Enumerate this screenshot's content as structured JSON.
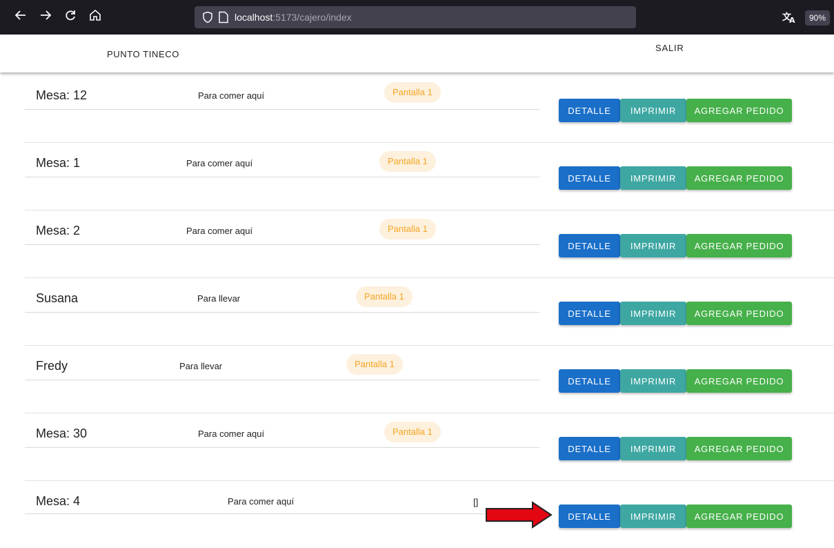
{
  "browser": {
    "url_host": "localhost",
    "url_rest": ":5173/cajero/index",
    "zoom": "90%",
    "icons": [
      "back-icon",
      "forward-icon",
      "reload-icon",
      "home-icon",
      "shield-icon",
      "page-icon",
      "translate-icon"
    ]
  },
  "header": {
    "brand": "PUNTO TINECO",
    "logout_label": "SALIR"
  },
  "buttons": {
    "detalle": "DETALLE",
    "imprimir": "IMPRIMIR",
    "agregar": "AGREGAR PEDIDO"
  },
  "colors": {
    "detalle": "#1a6fc9",
    "imprimir": "#3ea7a2",
    "agregar": "#46b04a",
    "chip_text": "#f5a623",
    "chip_bg": "#fdf0dd",
    "annotation_arrow": "#e30613"
  },
  "orders": [
    {
      "name": "Mesa: 12",
      "type": "Para comer aquí",
      "screen": "Pantalla 1"
    },
    {
      "name": "Mesa: 1",
      "type": "Para comer aquí",
      "screen": "Pantalla 1"
    },
    {
      "name": "Mesa: 2",
      "type": "Para comer aquí",
      "screen": "Pantalla 1"
    },
    {
      "name": "Susana",
      "type": "Para llevar",
      "screen": "Pantalla 1"
    },
    {
      "name": "Fredy",
      "type": "Para llevar",
      "screen": "Pantalla 1"
    },
    {
      "name": "Mesa: 30",
      "type": "Para comer aquí",
      "screen": "Pantalla 1"
    },
    {
      "name": "Mesa: 4",
      "type": "Para comer aquí",
      "screen": "[]"
    }
  ]
}
